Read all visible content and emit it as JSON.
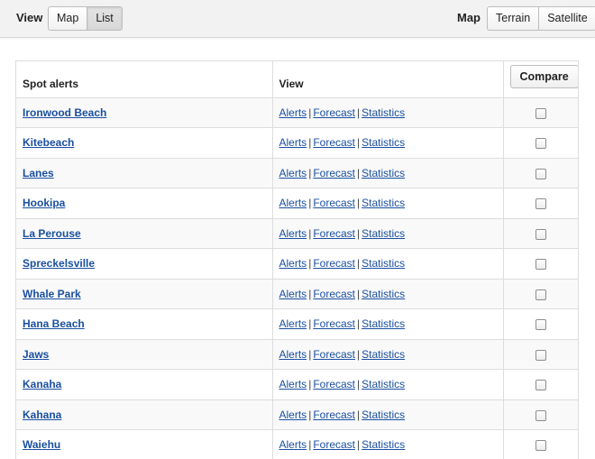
{
  "toolbar": {
    "view_label": "View",
    "view_options": [
      "Map",
      "List"
    ],
    "view_selected": "List",
    "map_label": "Map",
    "map_options": [
      "Terrain",
      "Satellite"
    ]
  },
  "table": {
    "headers": {
      "spot": "Spot alerts",
      "view": "View",
      "compare_button": "Compare"
    },
    "links": {
      "alerts": "Alerts",
      "forecast": "Forecast",
      "statistics": "Statistics",
      "separator": "|"
    },
    "rows": [
      {
        "name": "Ironwood Beach",
        "checked": false
      },
      {
        "name": "Kitebeach",
        "checked": false
      },
      {
        "name": "Lanes",
        "checked": false
      },
      {
        "name": "Hookipa",
        "checked": false
      },
      {
        "name": "La Perouse",
        "checked": false
      },
      {
        "name": "Spreckelsville",
        "checked": false
      },
      {
        "name": "Whale Park",
        "checked": false
      },
      {
        "name": "Hana Beach",
        "checked": false
      },
      {
        "name": "Jaws",
        "checked": false
      },
      {
        "name": "Kanaha",
        "checked": false
      },
      {
        "name": "Kahana",
        "checked": false
      },
      {
        "name": "Waiehu",
        "checked": false
      }
    ]
  }
}
